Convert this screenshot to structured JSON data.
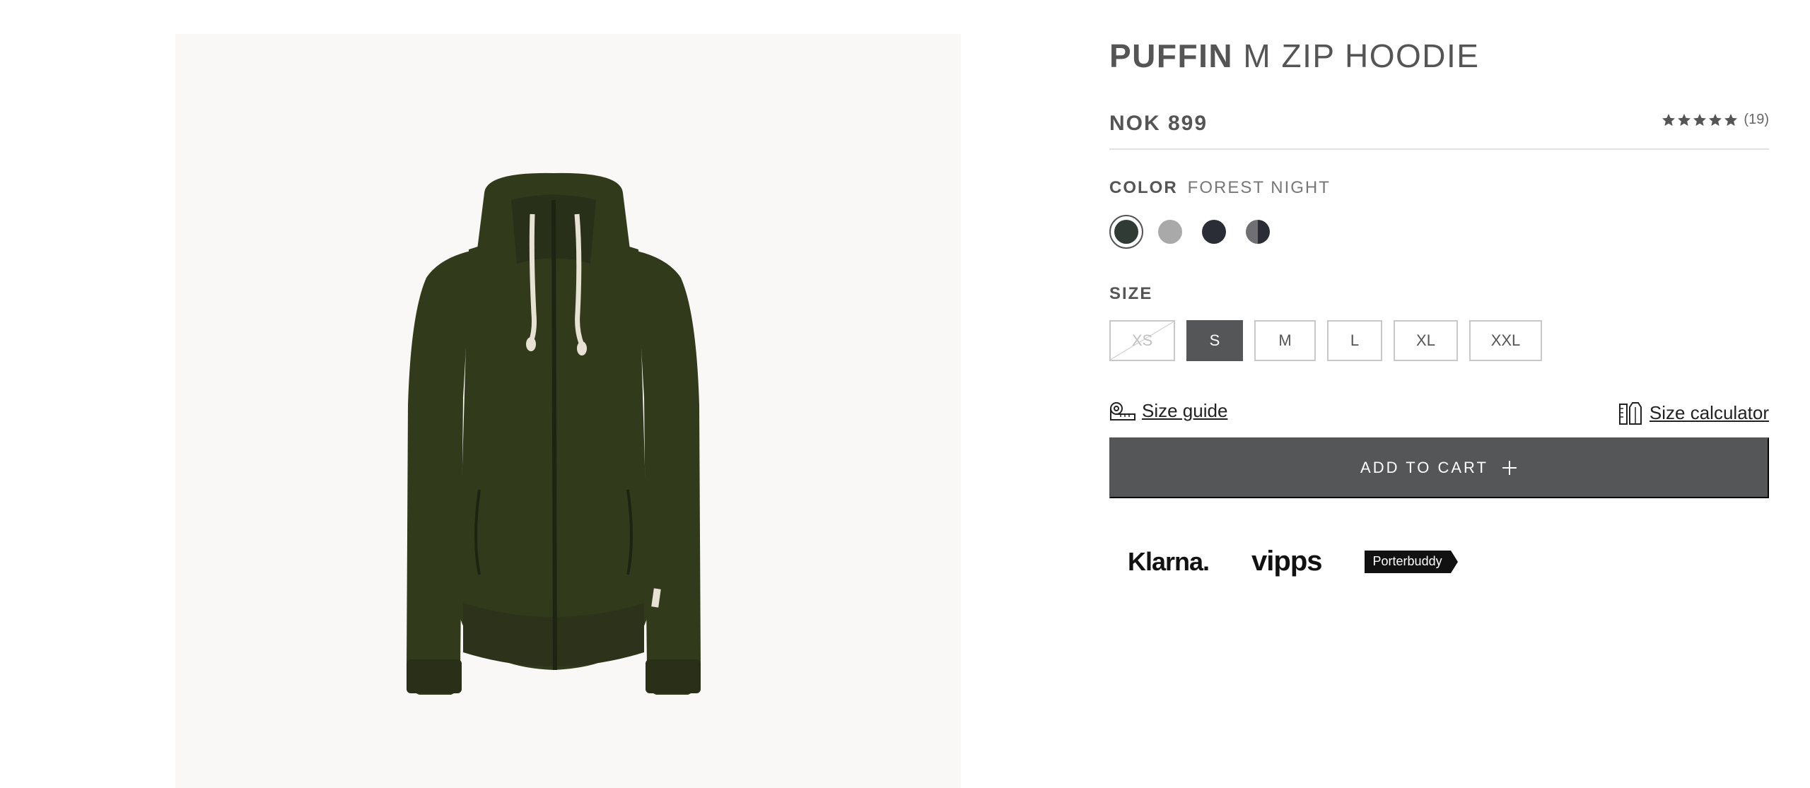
{
  "product": {
    "brand": "PUFFIN",
    "model": "M ZIP HOODIE",
    "price": "NOK 899",
    "rating": {
      "stars": 5,
      "count": "(19)"
    }
  },
  "color": {
    "label": "COLOR",
    "selected_name": "FOREST NIGHT",
    "swatches": [
      {
        "name": "forest-night",
        "hex": "#2f3b34",
        "selected": true
      },
      {
        "name": "grey",
        "hex": "#a9a9a9",
        "selected": false
      },
      {
        "name": "navy",
        "hex": "#2a2d35",
        "selected": false
      },
      {
        "name": "two-tone",
        "hex": "#6f6f74",
        "selected": false
      }
    ]
  },
  "size": {
    "label": "SIZE",
    "options": [
      {
        "label": "XS",
        "state": "unavailable"
      },
      {
        "label": "S",
        "state": "selected"
      },
      {
        "label": "M",
        "state": "available"
      },
      {
        "label": "L",
        "state": "available"
      },
      {
        "label": "XL",
        "state": "available"
      },
      {
        "label": "XXL",
        "state": "available"
      }
    ]
  },
  "links": {
    "size_guide": "Size guide",
    "size_calculator": "Size calculator"
  },
  "cart": {
    "label": "ADD TO CART"
  },
  "payments": {
    "klarna": "Klarna.",
    "vipps": "vipps",
    "porterbuddy": "Porterbuddy"
  }
}
